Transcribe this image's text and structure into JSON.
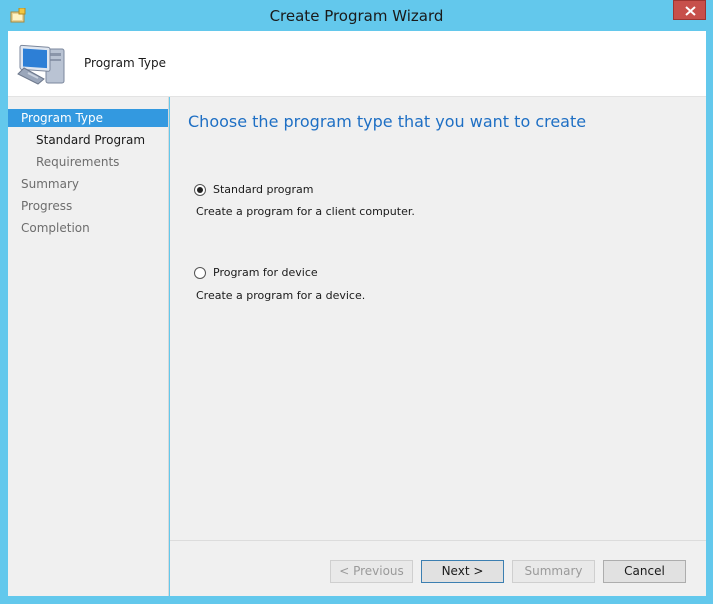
{
  "window": {
    "title": "Create Program Wizard"
  },
  "header": {
    "title": "Program Type"
  },
  "nav": {
    "items": [
      {
        "label": "Program Type"
      },
      {
        "label": "Standard Program"
      },
      {
        "label": "Requirements"
      },
      {
        "label": "Summary"
      },
      {
        "label": "Progress"
      },
      {
        "label": "Completion"
      }
    ]
  },
  "main": {
    "title": "Choose the program type that you want to create",
    "options": [
      {
        "label": "Standard program",
        "description": "Create a program for a client computer.",
        "selected": true
      },
      {
        "label": "Program for device",
        "description": "Create a program for a device.",
        "selected": false
      }
    ]
  },
  "buttons": {
    "previous": "< Previous",
    "next": "Next >",
    "summary": "Summary",
    "cancel": "Cancel"
  }
}
